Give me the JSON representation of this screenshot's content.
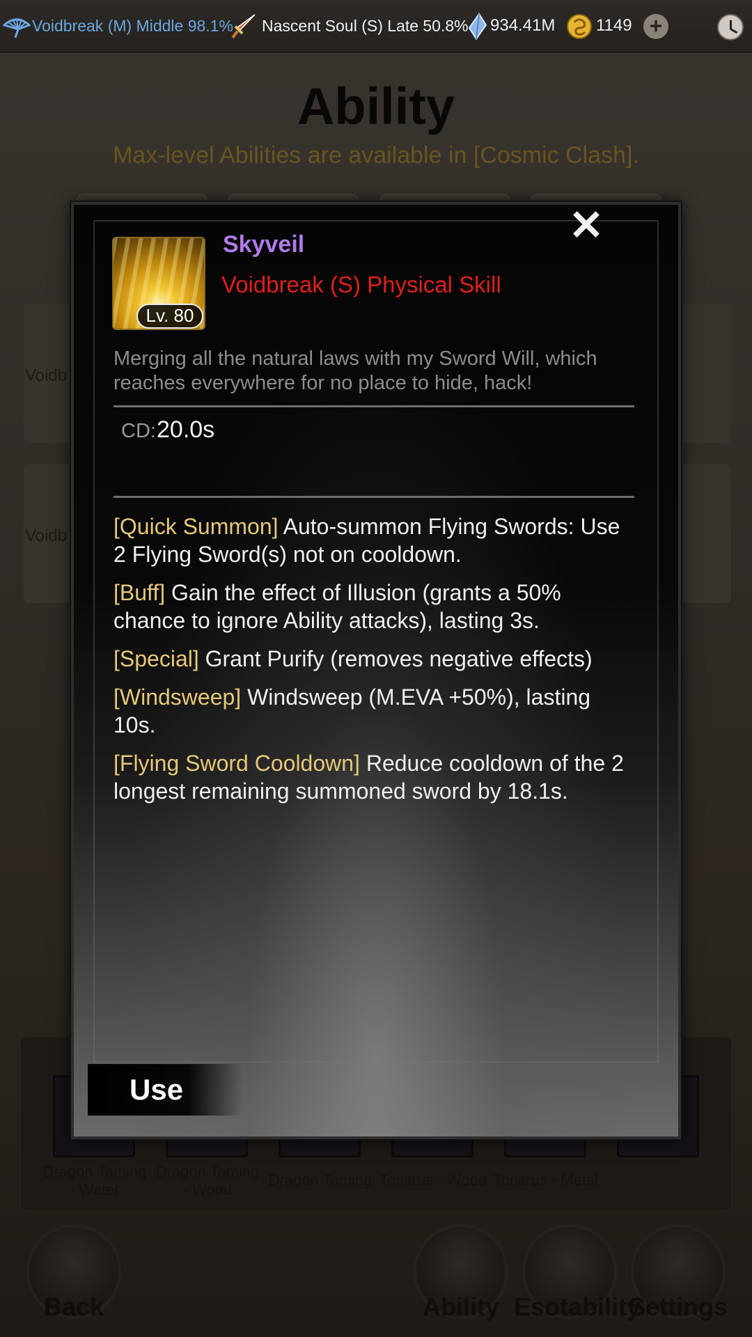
{
  "topbar": {
    "realm": "Voidbreak (M) Middle 98.1%",
    "soul": "Nascent Soul (S) Late 50.8%",
    "spirit_stones": "934.41M",
    "currency": "1149",
    "plus_label": "+"
  },
  "page": {
    "title": "Ability",
    "notice": "Max-level Abilities are available in [Cosmic Clash].",
    "row_labels": [
      "Voidb",
      "Voidb"
    ],
    "slots": [
      {
        "label": "Dragon Taming - Water"
      },
      {
        "label": "Dragon Taming - Wood"
      },
      {
        "label": "Dragon Taming"
      },
      {
        "label": "Tonitrus - Wood"
      },
      {
        "label": "Tonitrus - Metal"
      }
    ],
    "nav": {
      "back": "Back",
      "ability": "Ability",
      "esotability": "Esotability",
      "settings": "Settings"
    }
  },
  "modal": {
    "close_label": "✕",
    "skill_name": "Skyveil",
    "skill_type": "Voidbreak (S) Physical Skill",
    "level": "Lv. 80",
    "description": "Merging all the natural laws with my Sword Will, which reaches everywhere for no place to hide, hack!",
    "cd_label": "CD:",
    "cd_value": "20.0s",
    "effects": [
      {
        "tag": "[Quick Summon]",
        "text": " Auto-summon Flying Swords: Use 2 Flying Sword(s) not on cooldown."
      },
      {
        "tag": "[Buff]",
        "text": " Gain the effect of Illusion (grants a 50% chance to ignore Ability attacks), lasting 3s."
      },
      {
        "tag": "[Special]",
        "text": " Grant Purify (removes negative effects)"
      },
      {
        "tag": "[Windsweep]",
        "text": " Windsweep (M.EVA +50%), lasting 10s."
      },
      {
        "tag": "[Flying Sword Cooldown]",
        "text": " Reduce cooldown of the 2 longest remaining summoned sword by 18.1s."
      }
    ],
    "use_label": "Use"
  },
  "colors": {
    "realm_blue": "#6aa7e0",
    "skill_name_purple": "#b07ae8",
    "skill_type_red": "#e0201c",
    "effect_tag_gold": "#e6c878",
    "notice_gold": "#c9a13c"
  },
  "icons": {
    "realm": "fan-icon",
    "soul": "sword-icon",
    "spirit_stones": "crystal-icon",
    "currency": "coin-icon",
    "clock": "clock-icon"
  }
}
